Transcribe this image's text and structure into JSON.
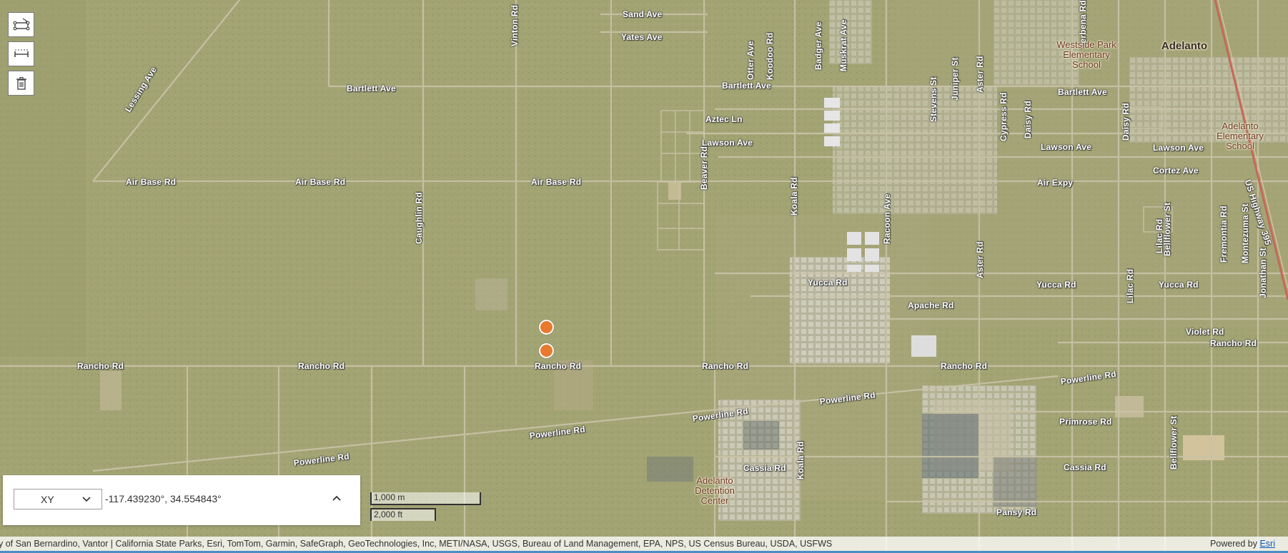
{
  "map": {
    "road_labels": [
      {
        "text": "Lessing Ave",
        "orient": "angled"
      },
      {
        "text": "Bartlett Ave",
        "orient": "h"
      },
      {
        "text": "Bartlett Ave",
        "orient": "h"
      },
      {
        "text": "Bartlett Ave",
        "orient": "h"
      },
      {
        "text": "Air Base Rd",
        "orient": "h"
      },
      {
        "text": "Air Base Rd",
        "orient": "h"
      },
      {
        "text": "Air Base Rd",
        "orient": "h"
      },
      {
        "text": "Air Expy",
        "orient": "h"
      },
      {
        "text": "Rancho Rd",
        "orient": "h"
      },
      {
        "text": "Rancho Rd",
        "orient": "h"
      },
      {
        "text": "Rancho Rd",
        "orient": "h"
      },
      {
        "text": "Rancho Rd",
        "orient": "h"
      },
      {
        "text": "Rancho Rd",
        "orient": "h"
      },
      {
        "text": "Rancho Rd",
        "orient": "h"
      },
      {
        "text": "Powerline Rd",
        "orient": "angled"
      },
      {
        "text": "Powerline Rd",
        "orient": "angled"
      },
      {
        "text": "Powerline Rd",
        "orient": "angled"
      },
      {
        "text": "Powerline Rd",
        "orient": "angled"
      },
      {
        "text": "Powerline Rd",
        "orient": "angled"
      },
      {
        "text": "Caughlin Rd",
        "orient": "v"
      },
      {
        "text": "Vinton Rd",
        "orient": "v"
      },
      {
        "text": "Beaver Rd",
        "orient": "v"
      },
      {
        "text": "Koala Rd",
        "orient": "v"
      },
      {
        "text": "Koala Rd",
        "orient": "v"
      },
      {
        "text": "Racoon Ave",
        "orient": "v"
      },
      {
        "text": "Otter Ave",
        "orient": "v"
      },
      {
        "text": "Koodoo Rd",
        "orient": "v"
      },
      {
        "text": "Badger Ave",
        "orient": "v"
      },
      {
        "text": "Muskrat Ave",
        "orient": "v"
      },
      {
        "text": "Sand Ave",
        "orient": "h"
      },
      {
        "text": "Yates Ave",
        "orient": "h"
      },
      {
        "text": "Aztec Ln",
        "orient": "h"
      },
      {
        "text": "Lawson Ave",
        "orient": "h"
      },
      {
        "text": "Lawson Ave",
        "orient": "h"
      },
      {
        "text": "Lawson Ave",
        "orient": "h"
      },
      {
        "text": "Cortez Ave",
        "orient": "h"
      },
      {
        "text": "Yucca Rd",
        "orient": "h"
      },
      {
        "text": "Yucca Rd",
        "orient": "h"
      },
      {
        "text": "Yucca Rd",
        "orient": "h"
      },
      {
        "text": "Apache Rd",
        "orient": "h"
      },
      {
        "text": "Violet Rd",
        "orient": "h"
      },
      {
        "text": "Primrose Rd",
        "orient": "h"
      },
      {
        "text": "Cassia Rd",
        "orient": "h"
      },
      {
        "text": "Cassia Rd",
        "orient": "h"
      },
      {
        "text": "Pansy Rd",
        "orient": "h"
      },
      {
        "text": "Stevens St",
        "orient": "v"
      },
      {
        "text": "Juniper St",
        "orient": "v"
      },
      {
        "text": "Aster Rd",
        "orient": "v"
      },
      {
        "text": "Aster Rd",
        "orient": "v"
      },
      {
        "text": "Cypress Rd",
        "orient": "v"
      },
      {
        "text": "Daisy Rd",
        "orient": "v"
      },
      {
        "text": "Daisy Rd",
        "orient": "v"
      },
      {
        "text": "Lilac Rd",
        "orient": "v"
      },
      {
        "text": "Lilac Rd",
        "orient": "v"
      },
      {
        "text": "Verbena Rd",
        "orient": "v"
      },
      {
        "text": "Bellflower St",
        "orient": "v"
      },
      {
        "text": "Bellflower St",
        "orient": "v"
      },
      {
        "text": "Fremontia Rd",
        "orient": "v"
      },
      {
        "text": "Montezuma St",
        "orient": "v"
      },
      {
        "text": "Jonathan St",
        "orient": "v"
      },
      {
        "text": "US Highway 395",
        "orient": "angled"
      }
    ],
    "places": [
      {
        "text": "Westside Park\nElementary\nSchool",
        "kind": "poi"
      },
      {
        "text": "Adelanto",
        "kind": "city"
      },
      {
        "text": "Adelanto\nElementary\nSchool",
        "kind": "poi"
      },
      {
        "text": "Adelanto\nDetention\nCenter",
        "kind": "poi"
      }
    ],
    "markers": [
      {
        "color": "#e8792d"
      },
      {
        "color": "#e8792d"
      }
    ],
    "colors": {
      "terrain": "#a2a474",
      "road": "#c9c3a8",
      "highway": "#c46a5a",
      "marker": "#e8792d"
    }
  },
  "toolbar": {
    "items": [
      {
        "name": "sketch-icon",
        "label": ""
      },
      {
        "name": "measure-icon",
        "label": ""
      },
      {
        "name": "trash-icon",
        "label": ""
      }
    ]
  },
  "coordinate_widget": {
    "mode": "XY",
    "value": "-117.439230°, 34.554843°"
  },
  "scale": {
    "metric": "1,000 m",
    "imperial": "2,000 ft"
  },
  "attribution": {
    "text": "y of San Bernardino, Vantor | California State Parks, Esri, TomTom, Garmin, SafeGraph, GeoTechnologies, Inc, METI/NASA, USGS, Bureau of Land Management, EPA, NPS, US Census Bureau, USDA, USFWS",
    "powered_by": "Powered by",
    "esri": "Esri"
  }
}
